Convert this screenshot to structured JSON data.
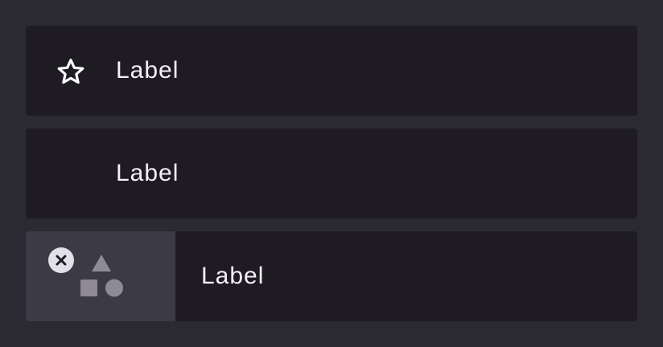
{
  "list": {
    "items": [
      {
        "label": "Label",
        "leading": "star-outline-icon"
      },
      {
        "label": "Label",
        "leading": "none"
      },
      {
        "label": "Label",
        "leading": "image-placeholder-with-remove-icon"
      }
    ]
  },
  "colors": {
    "background": "#2b2932",
    "surface": "#1e1c22",
    "media_surface": "#3c3a45",
    "text": "#f3f0f7",
    "placeholder_shapes": "#8e8b96",
    "remove_badge": "#e2e0e8"
  }
}
